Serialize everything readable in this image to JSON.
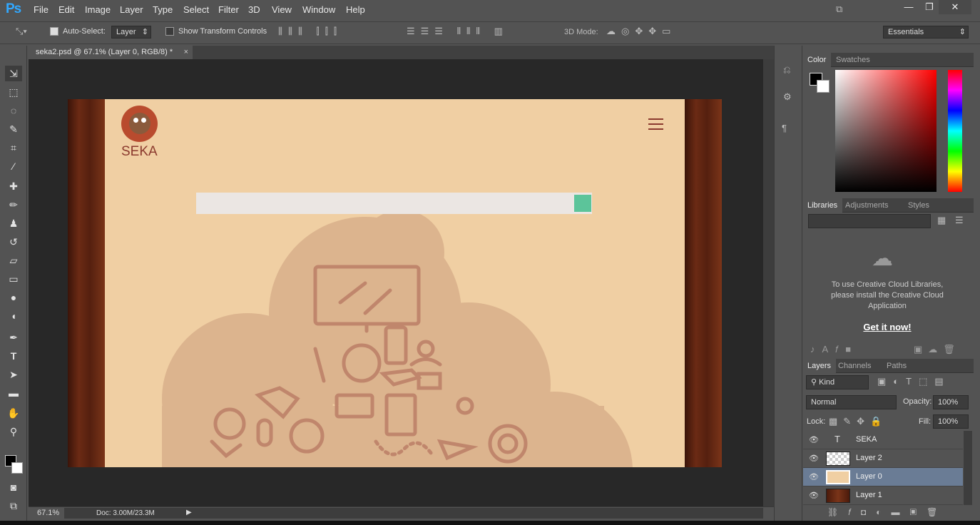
{
  "app": {
    "logo": "Ps",
    "menus": [
      "File",
      "Edit",
      "Image",
      "Layer",
      "Type",
      "Select",
      "Filter",
      "3D",
      "View",
      "Window",
      "Help"
    ]
  },
  "options": {
    "auto_select": "Auto-Select:",
    "layer_select": "Layer",
    "show_transform": "Show Transform Controls",
    "mode_3d": "3D Mode:",
    "workspace": "Essentials"
  },
  "document": {
    "tab_title": "seka2.psd @ 67.1% (Layer 0, RGB/8) *",
    "zoom": "67.1%",
    "doc_size": "Doc: 3.00M/23.3M"
  },
  "site": {
    "brand": "SEKA"
  },
  "color_panel": {
    "tabs": [
      "Color",
      "Swatches"
    ]
  },
  "libraries_panel": {
    "tabs": [
      "Libraries",
      "Adjustments",
      "Styles"
    ],
    "message": "To use Creative Cloud Libraries, please install the Creative Cloud Application",
    "cta": "Get it now!"
  },
  "layers_panel": {
    "tabs": [
      "Layers",
      "Channels",
      "Paths"
    ],
    "filter": "Kind",
    "blend_mode": "Normal",
    "opacity_label": "Opacity:",
    "opacity": "100%",
    "lock_label": "Lock:",
    "fill_label": "Fill:",
    "fill": "100%",
    "layers": [
      {
        "name": "SEKA",
        "kind": "text"
      },
      {
        "name": "Layer 2",
        "kind": "transparent"
      },
      {
        "name": "Layer 0",
        "kind": "image",
        "selected": true
      },
      {
        "name": "Layer 1",
        "kind": "wood"
      }
    ]
  },
  "colors": {
    "accent": "#31a8ff",
    "canvas_bg": "#f0cfa3",
    "cloud": "#dcb48e",
    "icon_stroke": "#c0866c",
    "search_btn": "#5cc49a",
    "brand_text": "#8b3a2e"
  }
}
